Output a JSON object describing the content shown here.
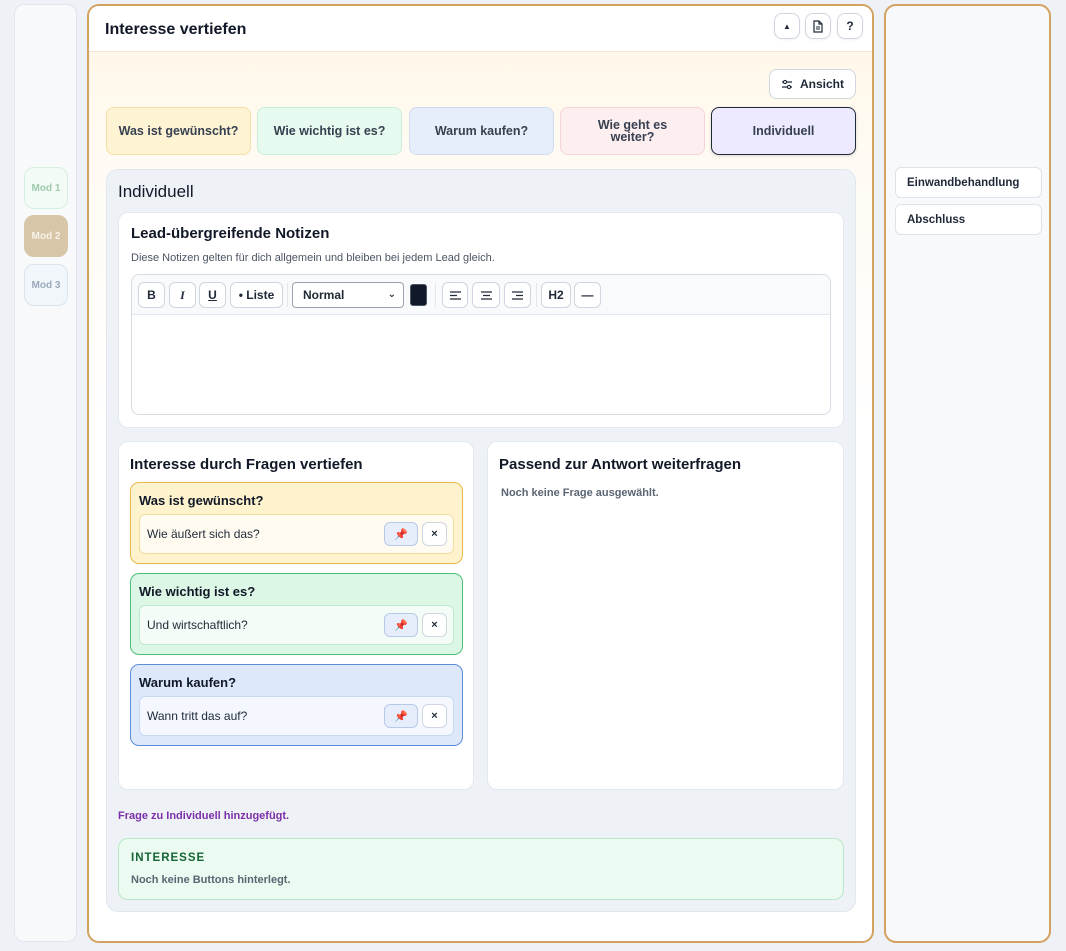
{
  "left_rail": {
    "mods": [
      "Mod 1",
      "Mod 2",
      "Mod 3"
    ]
  },
  "header": {
    "title": "Interesse vertiefen",
    "buttons": {
      "collapse_icon": "triangle-up-icon",
      "document_icon": "document-icon",
      "help_label": "?"
    }
  },
  "view_button": {
    "label": "Ansicht",
    "icon": "sliders-icon"
  },
  "topic_tabs": [
    {
      "label": "Was ist gewünscht?",
      "bg": "#fef4d4",
      "border": "#f3dfa6"
    },
    {
      "label": "Wie wichtig ist es?",
      "bg": "#e6faf0",
      "border": "#c9eedb"
    },
    {
      "label": "Warum kaufen?",
      "bg": "#e7eefb",
      "border": "#d0dcef"
    },
    {
      "label": "Wie geht es weiter?",
      "bg": "#fdeef0",
      "border": "#f5d3d9"
    },
    {
      "label": "Individuell",
      "bg": "#ede9fe",
      "border": "#1f2937",
      "active": true
    }
  ],
  "panel": {
    "title": "Individuell",
    "notes": {
      "title": "Lead-übergreifende Notizen",
      "subtitle": "Diese Notizen gelten für dich allgemein und bleiben bei jedem Lead gleich.",
      "toolbar": {
        "bold": "B",
        "italic": "I",
        "underline": "U",
        "list": "• Liste",
        "format_select": "Normal",
        "text_color": "#111827",
        "heading": "H2",
        "rule": "—"
      },
      "content": ""
    },
    "questions_card": {
      "title": "Interesse durch Fragen vertiefen",
      "groups": [
        {
          "title": "Was ist gewünscht?",
          "question": "Wie äußert sich das?",
          "bg": "#fef3cd",
          "border": "#e9b949",
          "item_bg": "#fffbf0",
          "item_border": "#f3dca0"
        },
        {
          "title": "Wie wichtig ist es?",
          "question": "Und wirtschaftlich?",
          "bg": "#ddf7e7",
          "border": "#4fbf76",
          "item_bg": "#f3fcf6",
          "item_border": "#bfe9cf"
        },
        {
          "title": "Warum kaufen?",
          "question": "Wann tritt das auf?",
          "bg": "#dde9fb",
          "border": "#5c8ed8",
          "item_bg": "#f4f8fe",
          "item_border": "#c7d8f2"
        }
      ]
    },
    "followup_card": {
      "title": "Passend zur Antwort weiterfragen",
      "empty": "Noch keine Frage ausgewählt."
    },
    "status_message": "Frage zu Individuell hinzugefügt.",
    "interest_box": {
      "title": "INTERESSE",
      "subtitle": "Noch keine Buttons hinterlegt."
    }
  },
  "right_rail": {
    "items": [
      "Einwandbehandlung",
      "Abschluss"
    ]
  },
  "colors": {
    "accent_border": "#d3a25f",
    "status_purple": "#7b2fa6"
  }
}
